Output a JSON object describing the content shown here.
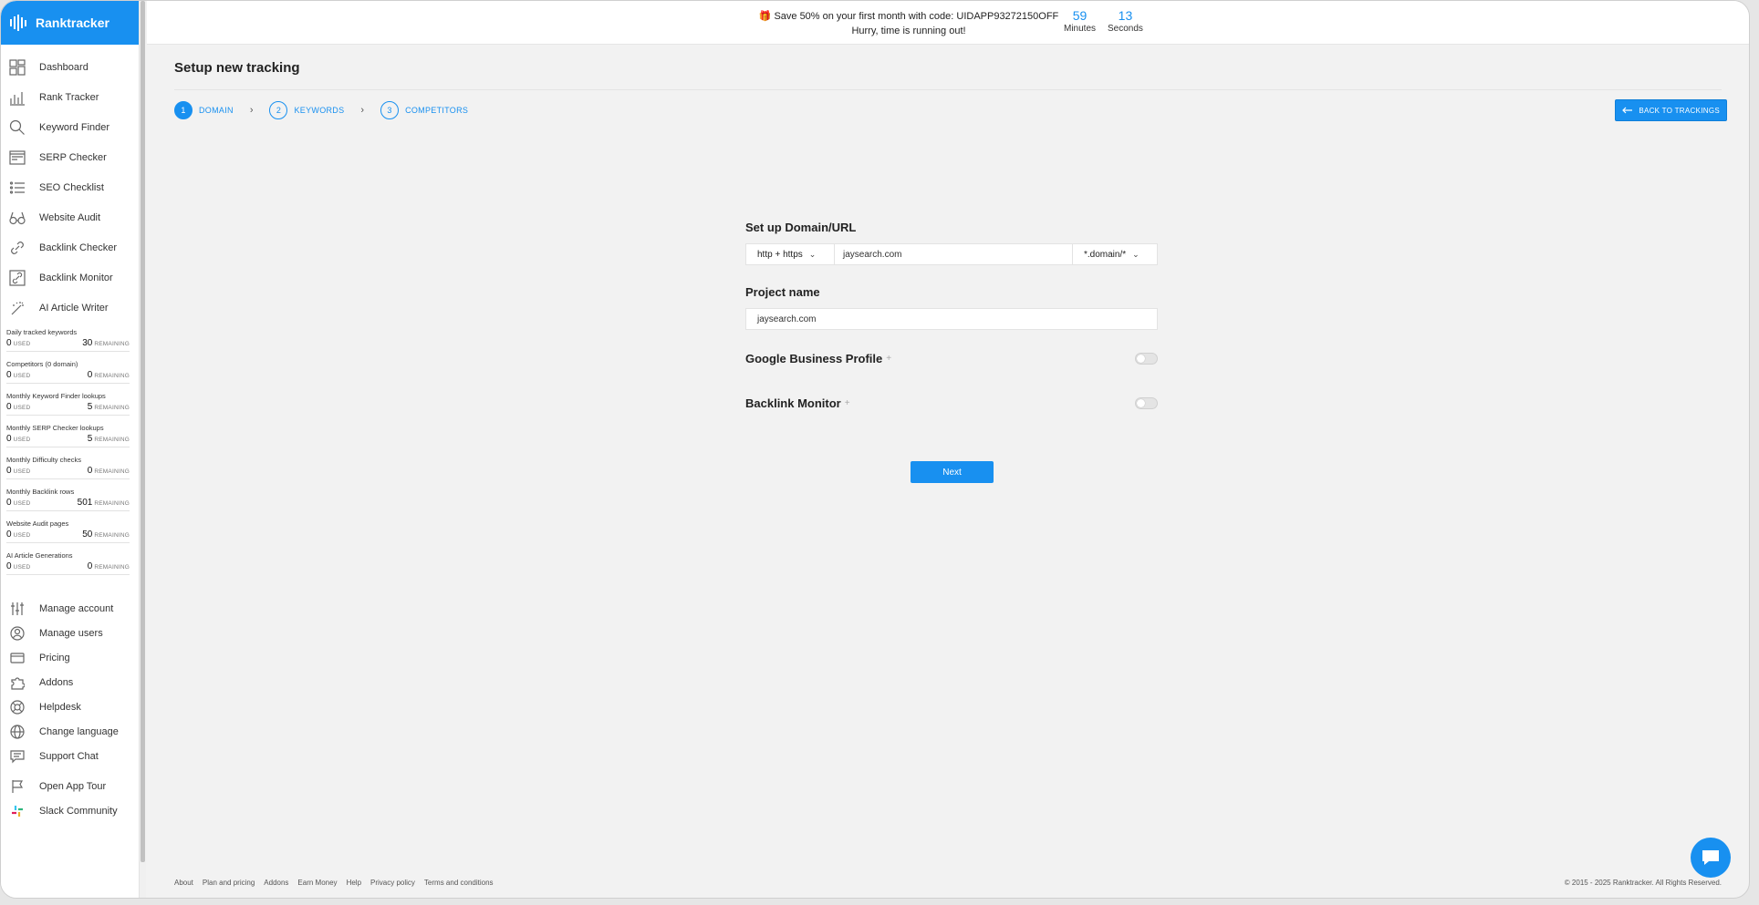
{
  "brand": {
    "name": "Ranktracker",
    "color": "#1890f0"
  },
  "sidebar": {
    "nav": [
      {
        "label": "Dashboard",
        "icon": "dashboard-icon"
      },
      {
        "label": "Rank Tracker",
        "icon": "bar-chart-icon"
      },
      {
        "label": "Keyword Finder",
        "icon": "keyword-search-icon"
      },
      {
        "label": "SERP Checker",
        "icon": "serp-window-icon"
      },
      {
        "label": "SEO Checklist",
        "icon": "checklist-icon"
      },
      {
        "label": "Website Audit",
        "icon": "glasses-icon"
      },
      {
        "label": "Backlink Checker",
        "icon": "link-icon"
      },
      {
        "label": "Backlink Monitor",
        "icon": "monitor-link-icon"
      },
      {
        "label": "AI Article Writer",
        "icon": "magic-wand-icon"
      }
    ],
    "quotas": [
      {
        "title": "Daily tracked keywords",
        "used": "0",
        "used_label": "USED",
        "remaining": "30",
        "remaining_label": "REMAINING"
      },
      {
        "title": "Competitors (0 domain)",
        "used": "0",
        "used_label": "USED",
        "remaining": "0",
        "remaining_label": "REMAINING"
      },
      {
        "title": "Monthly Keyword Finder lookups",
        "used": "0",
        "used_label": "USED",
        "remaining": "5",
        "remaining_label": "REMAINING"
      },
      {
        "title": "Monthly SERP Checker lookups",
        "used": "0",
        "used_label": "USED",
        "remaining": "5",
        "remaining_label": "REMAINING"
      },
      {
        "title": "Monthly Difficulty checks",
        "used": "0",
        "used_label": "USED",
        "remaining": "0",
        "remaining_label": "REMAINING"
      },
      {
        "title": "Monthly Backlink rows",
        "used": "0",
        "used_label": "USED",
        "remaining": "501",
        "remaining_label": "REMAINING"
      },
      {
        "title": "Website Audit pages",
        "used": "0",
        "used_label": "USED",
        "remaining": "50",
        "remaining_label": "REMAINING"
      },
      {
        "title": "AI Article Generations",
        "used": "0",
        "used_label": "USED",
        "remaining": "0",
        "remaining_label": "REMAINING"
      }
    ],
    "bottom_nav": [
      {
        "label": "Manage account",
        "icon": "sliders-icon"
      },
      {
        "label": "Manage users",
        "icon": "user-circle-icon"
      },
      {
        "label": "Pricing",
        "icon": "credit-card-icon"
      },
      {
        "label": "Addons",
        "icon": "puzzle-icon"
      },
      {
        "label": "Helpdesk",
        "icon": "lifebuoy-icon"
      },
      {
        "label": "Change language",
        "icon": "globe-icon"
      },
      {
        "label": "Support Chat",
        "icon": "chat-bubble-icon"
      },
      {
        "label": "Open App Tour",
        "icon": "flag-icon"
      },
      {
        "label": "Slack Community",
        "icon": "slack-icon"
      }
    ]
  },
  "banner": {
    "promo_line1": "Save 50% on your first month with code: UIDAPP93272150OFF",
    "promo_line2": "Hurry, time is running out!",
    "minutes": "59",
    "minutes_label": "Minutes",
    "seconds": "13",
    "seconds_label": "Seconds"
  },
  "main": {
    "title": "Setup new tracking",
    "steps": [
      {
        "num": "1",
        "label": "DOMAIN"
      },
      {
        "num": "2",
        "label": "KEYWORDS"
      },
      {
        "num": "3",
        "label": "COMPETITORS"
      }
    ],
    "step_sep": "›",
    "back_button": "BACK TO TRACKINGS"
  },
  "form": {
    "domain_label": "Set up Domain/URL",
    "protocol": "http + https",
    "url_value": "jaysearch.com",
    "scope": "*.domain/*",
    "project_label": "Project name",
    "project_value": "jaysearch.com",
    "gbp_label": "Google Business Profile",
    "backlink_label": "Backlink Monitor",
    "addon_mark": "+",
    "next_button": "Next"
  },
  "footer": {
    "links": [
      "About",
      "Plan and pricing",
      "Addons",
      "Earn Money",
      "Help",
      "Privacy policy",
      "Terms and conditions"
    ],
    "copyright": "© 2015 - 2025 Ranktracker. All Rights Reserved."
  }
}
